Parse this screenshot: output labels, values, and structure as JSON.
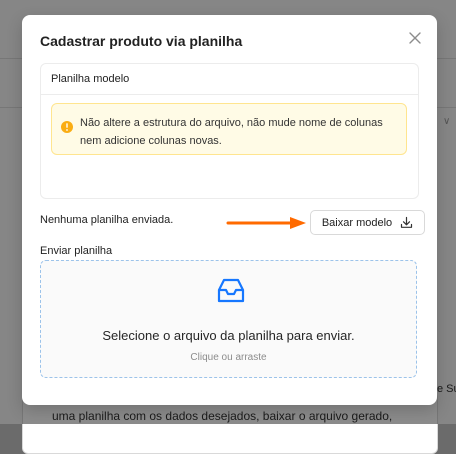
{
  "background": {
    "partial_text": "uma planilha com os dados desejados, baixar o arquivo gerado,",
    "partial_edge": "e Su"
  },
  "modal": {
    "title": "Cadastrar produto via planilha",
    "close_icon": "close-icon",
    "template_section": {
      "title": "Planilha modelo",
      "warning": "Não altere a estrutura do arquivo, não mude nome de colunas nem adicione colunas novas.",
      "warning_icon": "exclamation-circle-icon",
      "download_button": "Baixar modelo",
      "download_icon": "download-icon"
    },
    "status_text": "Nenhuma planilha enviada.",
    "upload": {
      "label": "Enviar planilha",
      "icon": "inbox-icon",
      "main_text": "Selecione o arquivo da planilha para enviar.",
      "hint": "Clique ou arraste"
    }
  },
  "colors": {
    "accent": "#1677ff",
    "warning": "#faad14",
    "arrow": "#ff6a00"
  }
}
